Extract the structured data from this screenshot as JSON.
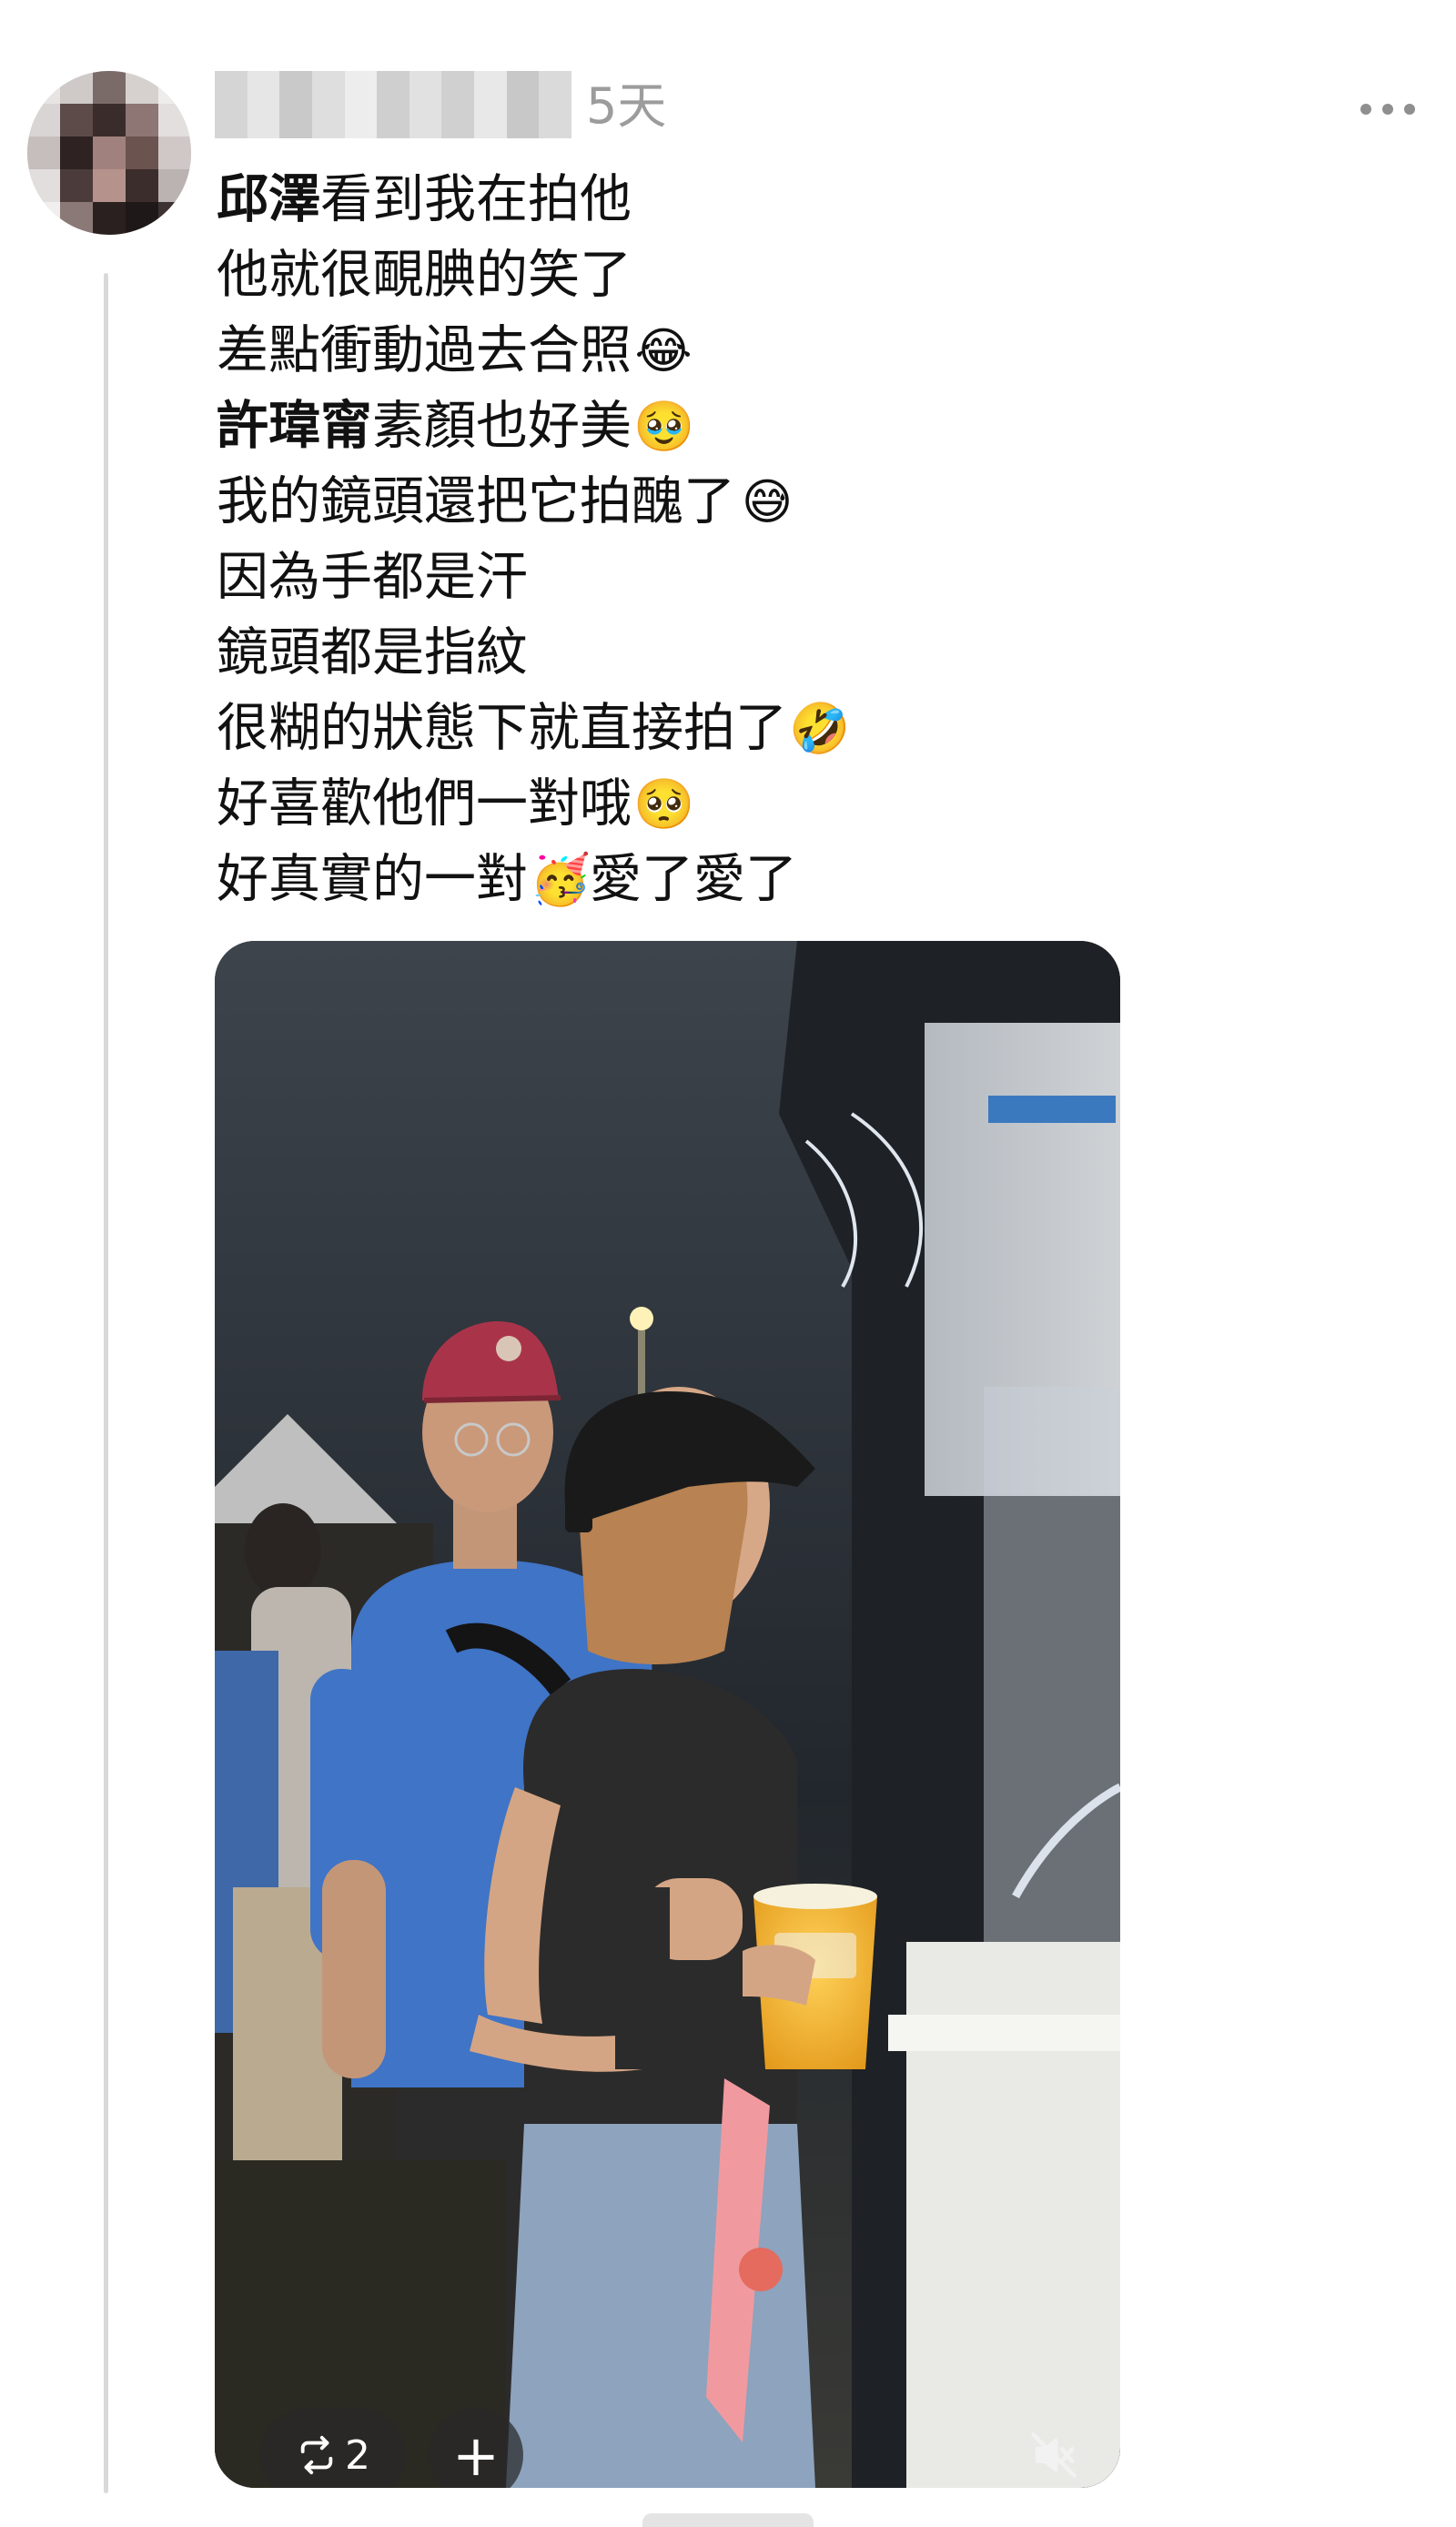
{
  "post": {
    "timestamp": "5天",
    "more_icon": "more-horizontal-icon",
    "lines": [
      {
        "bold": "邱澤",
        "text": "看到我在拍他",
        "emoji": ""
      },
      {
        "bold": "",
        "text": "他就很靦腆的笑了",
        "emoji": ""
      },
      {
        "bold": "",
        "text": "差點衝動過去合照",
        "emoji": "😂"
      },
      {
        "bold": "許瑋甯",
        "text": "素顏也好美",
        "emoji": "🥹"
      },
      {
        "bold": "",
        "text": "我的鏡頭還把它拍醜了",
        "emoji": "😅"
      },
      {
        "bold": "",
        "text": "因為手都是汗",
        "emoji": ""
      },
      {
        "bold": "",
        "text": "鏡頭都是指紋",
        "emoji": ""
      },
      {
        "bold": "",
        "text": "很糊的狀態下就直接拍了",
        "emoji": "🤣"
      },
      {
        "bold": "",
        "text": "好喜歡他們一對哦",
        "emoji": "🥺"
      },
      {
        "bold": "",
        "text": "好真實的一對",
        "emoji": "🥳",
        "after": "愛了愛了"
      }
    ]
  },
  "media": {
    "repost_count": "2",
    "repost_icon": "repost-icon",
    "add_icon": "plus-icon",
    "add_label": "+",
    "mute_icon": "speaker-muted-icon"
  },
  "colors": {
    "text": "#111111",
    "muted": "#9c9c9c",
    "thread_line": "#d9d9d9",
    "shirt_blue": "#3f74c6",
    "cap_red": "#a9344a"
  }
}
